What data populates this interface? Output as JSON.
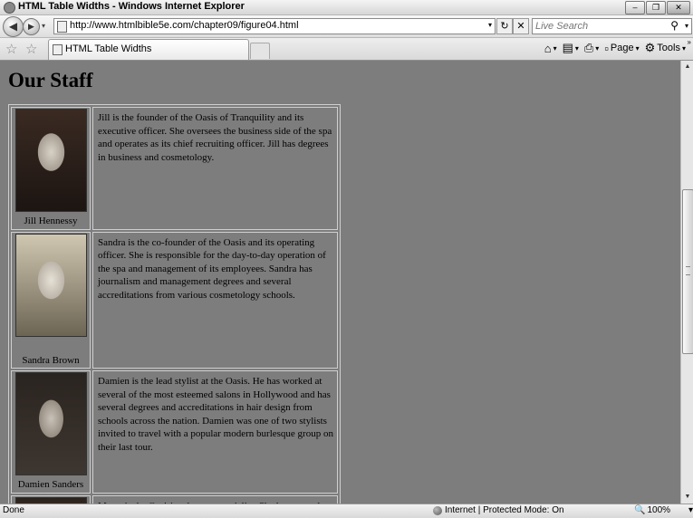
{
  "window": {
    "title": "HTML Table Widths - Windows Internet Explorer",
    "minimize": "–",
    "maximize": "❐",
    "close": "✕"
  },
  "address_bar": {
    "back": "◀",
    "forward": "▶",
    "dropdown": "▾",
    "url": "http://www.htmlbible5e.com/chapter09/figure04.html",
    "refresh": "↻",
    "stop": "✕",
    "search_placeholder": "Live Search",
    "search_icon": "⚲"
  },
  "tabs": {
    "favorites_star": "☆",
    "add_favorites": "☆",
    "active_tab": "HTML Table Widths"
  },
  "command_bar": {
    "home_icon": "⌂",
    "feeds_icon": "▤",
    "print_icon": "⎙",
    "page_label": "Page",
    "tools_label": "Tools",
    "dropdown": "▾",
    "chevron": "»"
  },
  "page": {
    "heading": "Our Staff",
    "staff": [
      {
        "name": "Jill Hennessy",
        "bio": "Jill is the founder of the Oasis of Tranquility and its executive officer. She oversees the business side of the spa and operates as its chief recruiting officer. Jill has degrees in business and cosmetology."
      },
      {
        "name": "Sandra Brown",
        "bio": "Sandra is the co-founder of the Oasis and its operating officer. She is responsible for the day-to-day operation of the spa and management of its employees. Sandra has journalism and management degrees and several accreditations from various cosmetology schools."
      },
      {
        "name": "Damien Sanders",
        "bio": "Damien is the lead stylist at the Oasis. He has worked at several of the most esteemed salons in Hollywood and has several degrees and accreditations in hair design from schools across the nation. Damien was one of two stylists invited to travel with a popular modern burlesque group on their last tour."
      },
      {
        "name": "",
        "bio": "Marty is the Oasis' makeover specialist. She has several"
      }
    ]
  },
  "status_bar": {
    "status": "Done",
    "zone": "Internet | Protected Mode: On",
    "zoom_icon": "🔍",
    "zoom": "100%",
    "dropdown": "▾"
  },
  "scrollbar": {
    "up": "▲",
    "down": "▼"
  }
}
